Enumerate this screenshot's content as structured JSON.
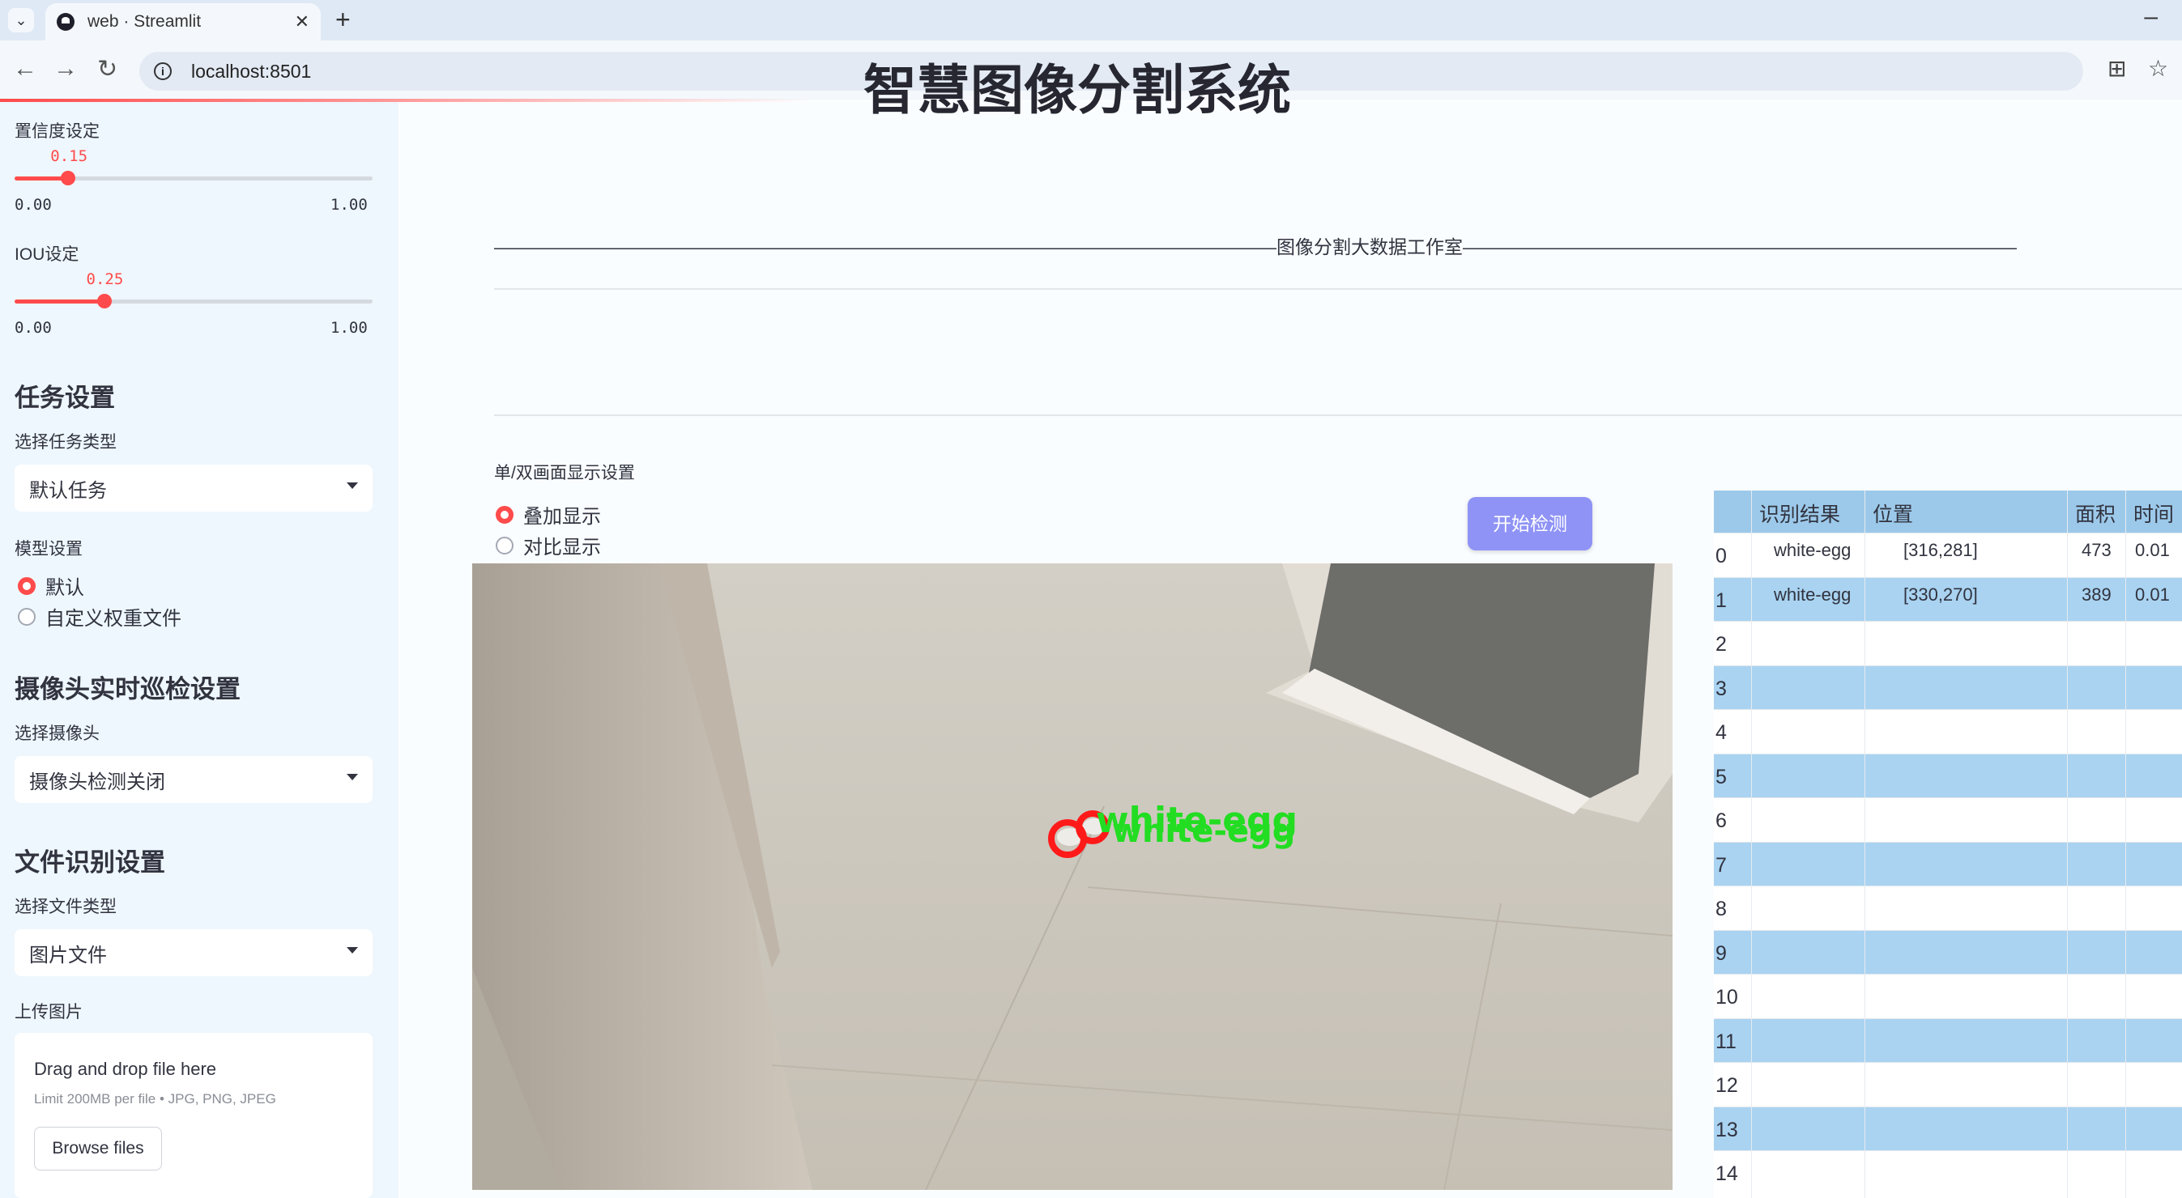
{
  "browser": {
    "tab_title": "web · Streamlit",
    "tab_close": "✕",
    "new_tab": "+",
    "tab_menu": "⌄",
    "minimize": "–",
    "back": "←",
    "forward": "→",
    "reload": "↻",
    "info": "i",
    "url": "localhost:8501",
    "translate": "⊞",
    "bookmark": "☆"
  },
  "sidebar": {
    "conf": {
      "label": "置信度设定",
      "value": "0.15",
      "min": "0.00",
      "max": "1.00",
      "fraction": 0.15
    },
    "iou": {
      "label": "IOU设定",
      "value": "0.25",
      "min": "0.00",
      "max": "1.00",
      "fraction": 0.25
    },
    "task": {
      "heading": "任务设置",
      "select_label": "选择任务类型",
      "selected": "默认任务"
    },
    "model": {
      "label": "模型设置",
      "options": [
        "默认",
        "自定义权重文件"
      ],
      "selected_index": 0
    },
    "camera": {
      "heading": "摄像头实时巡检设置",
      "select_label": "选择摄像头",
      "selected": "摄像头检测关闭"
    },
    "file": {
      "heading": "文件识别设置",
      "select_label": "选择文件类型",
      "selected": "图片文件"
    },
    "upload": {
      "label": "上传图片",
      "drag_text": "Drag and drop file here",
      "limit_text": "Limit 200MB per file • JPG, PNG, JPEG",
      "browse": "Browse files"
    }
  },
  "main": {
    "title": "智慧图像分割系统",
    "divider_text": "——————————————————————————————————————————图像分割大数据工作室——————————————————————————————————————————",
    "display": {
      "label": "单/双画面显示设置",
      "options": [
        "叠加显示",
        "对比显示"
      ],
      "selected_index": 0
    },
    "start_button": "开始检测",
    "detection_label": "white-egg"
  },
  "table": {
    "columns": [
      "识别结果",
      "位置",
      "面积",
      "时间"
    ],
    "rows": [
      {
        "index": "0",
        "result": "white-egg",
        "position": "[316,281]",
        "area": "473",
        "time": "0.01"
      },
      {
        "index": "1",
        "result": "white-egg",
        "position": "[330,270]",
        "area": "389",
        "time": "0.01"
      },
      {
        "index": "2"
      },
      {
        "index": "3"
      },
      {
        "index": "4"
      },
      {
        "index": "5"
      },
      {
        "index": "6"
      },
      {
        "index": "7"
      },
      {
        "index": "8"
      },
      {
        "index": "9"
      },
      {
        "index": "10"
      },
      {
        "index": "11"
      },
      {
        "index": "12"
      },
      {
        "index": "13"
      },
      {
        "index": "14"
      }
    ]
  },
  "colors": {
    "accent": "#ff4b4b",
    "button": "#8f93f5",
    "table_header": "#9cc9ea",
    "table_alt": "#a9d3f1",
    "sidebar": "#eef7fd",
    "detection_box": "#ff1a1a",
    "detection_text": "#22dd22"
  }
}
